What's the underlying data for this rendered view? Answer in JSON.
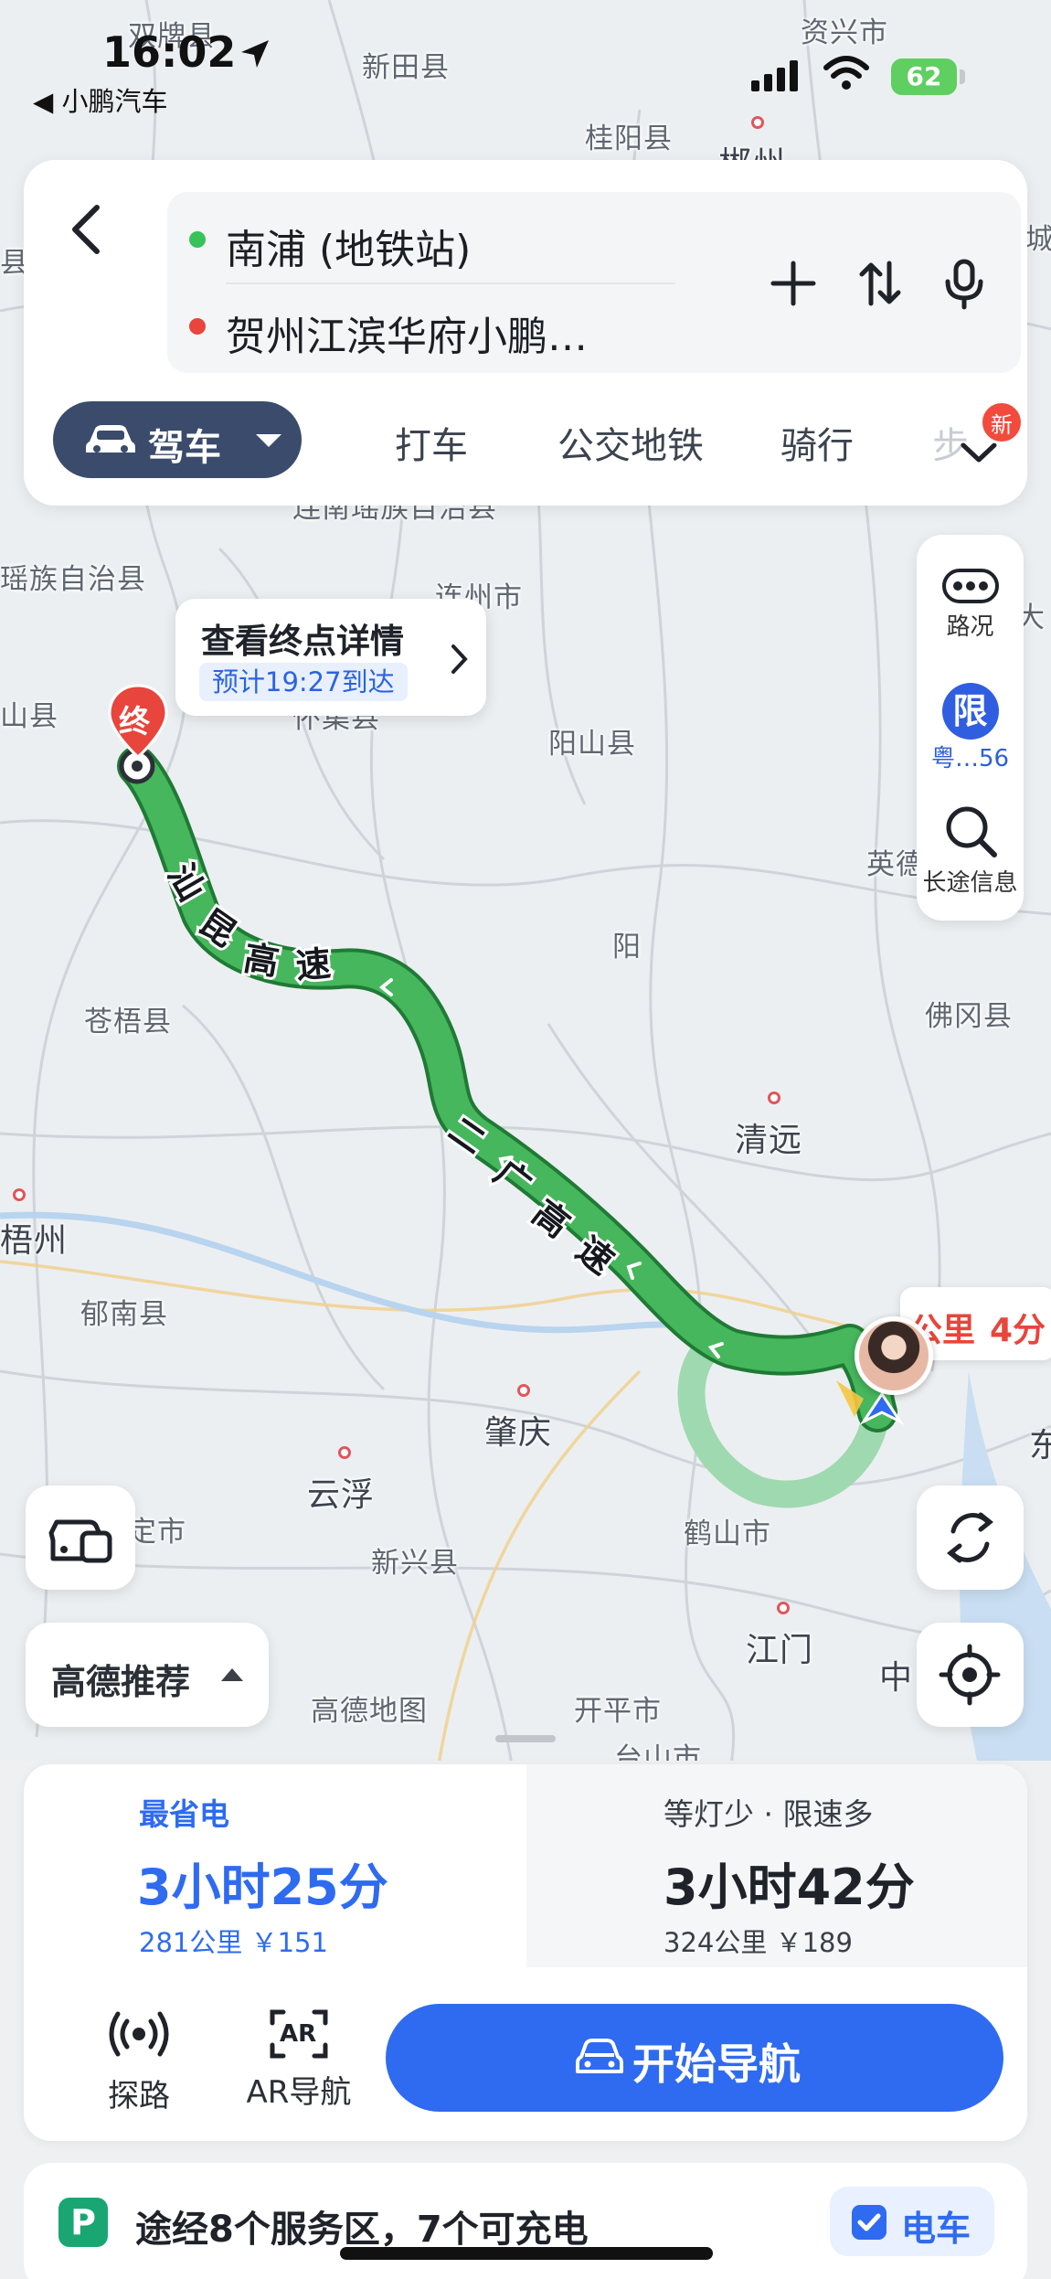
{
  "status_bar": {
    "time": "16:02",
    "back_app": "◀ 小鹏汽车",
    "battery": "62"
  },
  "search": {
    "origin": "南浦 (地铁站)",
    "destination": "贺州江滨华府小鹏…",
    "colors": {
      "origin_dot": "#37c25a",
      "destination_dot": "#e8453c"
    }
  },
  "modes": {
    "active": "驾车",
    "items": [
      "打车",
      "公交地铁",
      "骑行",
      "步"
    ],
    "new_badge": "新"
  },
  "right_tools": {
    "traffic": "路况",
    "limit_badge": "限",
    "limit_label": "粤…56",
    "longtrip": "长途信息"
  },
  "destination_popup": {
    "title": "查看终点详情",
    "eta": "预计19:27到达",
    "pin_label": "终"
  },
  "map": {
    "labels": [
      "双牌县",
      "资兴市",
      "新田县",
      "桂阳县",
      "郴州",
      "城",
      "县",
      "瑶族自治县",
      "连州市",
      "山县",
      "阳山县",
      "英德",
      "佛冈县",
      "苍梧县",
      "清远",
      "梧州",
      "郁南县",
      "肇庆",
      "云浮",
      "新兴县",
      "鹤山市",
      "江门",
      "开平市",
      "中",
      "东",
      "定市",
      "台山市",
      "怀集县",
      "连南瑶族自治县",
      "大",
      "阳"
    ],
    "road_labels": [
      "汕昆高速",
      "二广高速"
    ],
    "brand": "高德地图",
    "route_colors": {
      "main": "#3fae56",
      "alt": "#9fd9b0"
    }
  },
  "eta_tag": {
    "distance_fragment": "公里",
    "time_fragment": "4分"
  },
  "recommend": {
    "label": "高德推荐"
  },
  "plans": [
    {
      "tag": "最省电",
      "duration": "3小时25分",
      "meta": "281公里 ￥151",
      "selected": true
    },
    {
      "tag": "等灯少 · 限速多",
      "duration": "3小时42分",
      "meta": "324公里 ￥189",
      "selected": false
    }
  ],
  "footer": {
    "explore": "探路",
    "ar_nav": "AR导航",
    "ar_badge": "AR",
    "start": "开始导航"
  },
  "service": {
    "icon": "P",
    "text": "途经8个服务区，7个可充电",
    "ev_chip": "电车"
  }
}
